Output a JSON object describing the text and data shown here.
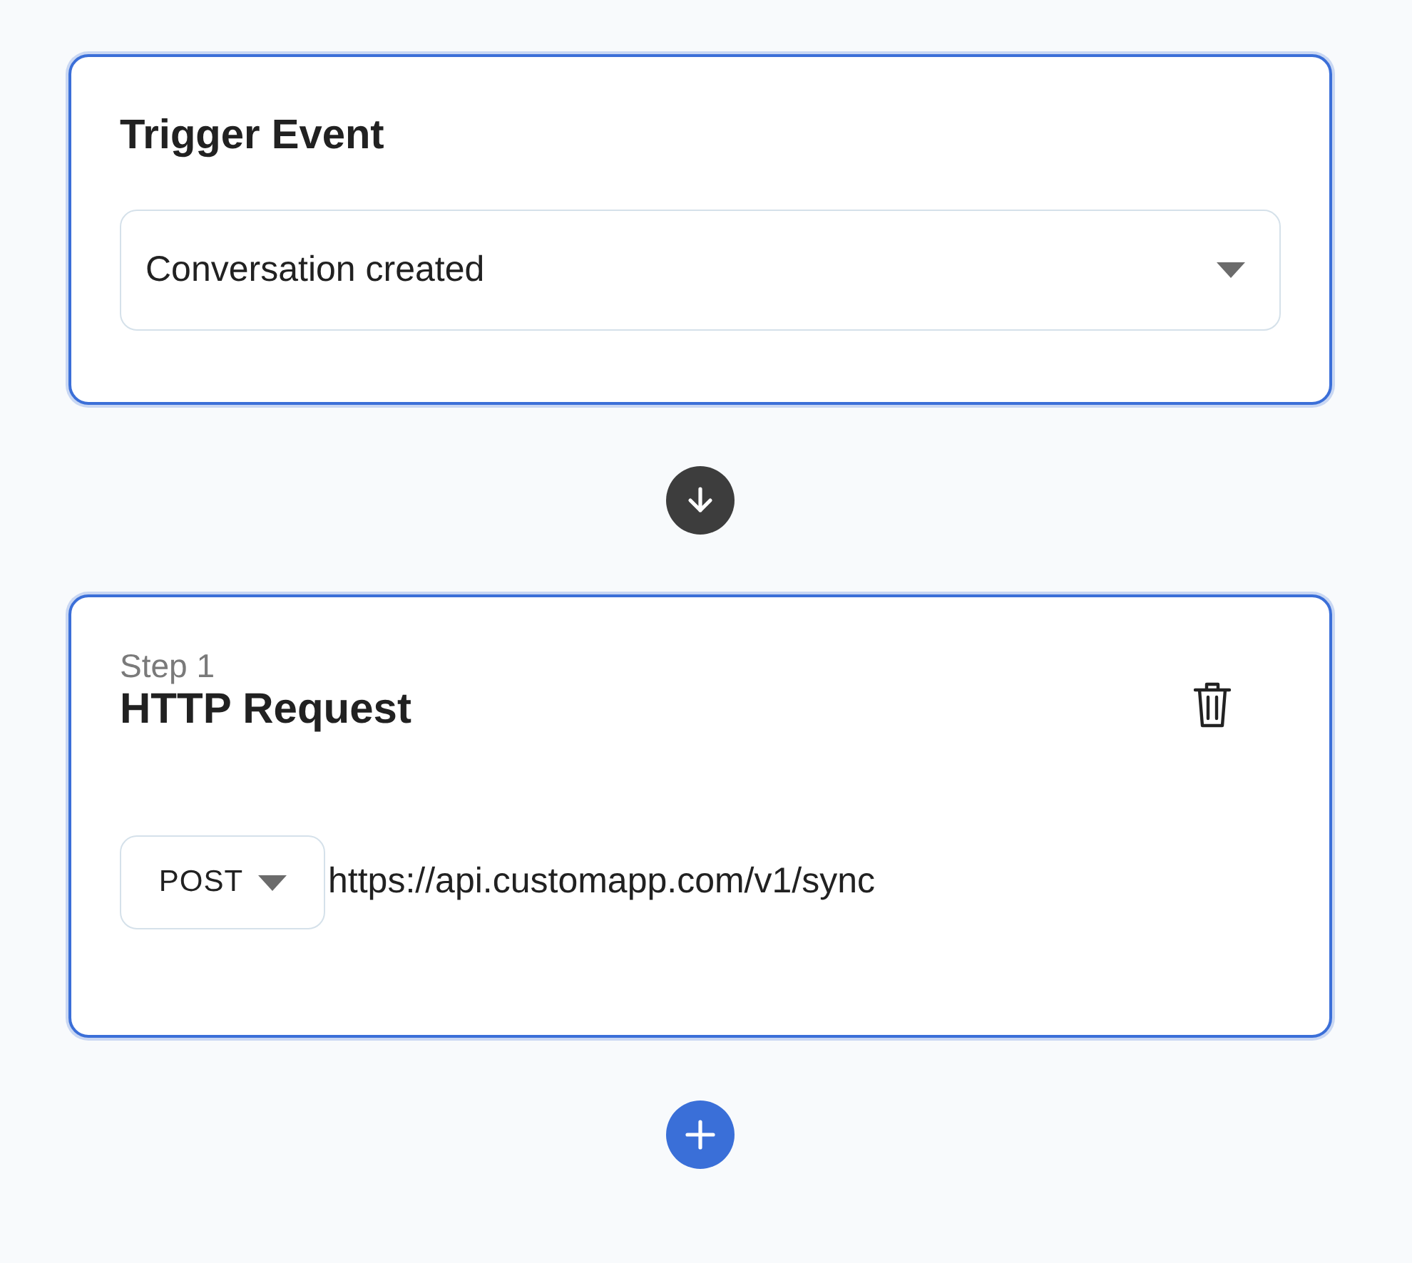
{
  "trigger": {
    "title": "Trigger Event",
    "event": "Conversation created"
  },
  "steps": [
    {
      "label": "Step 1",
      "title": "HTTP Request",
      "method": "POST",
      "url": "https://api.customapp.com/v1/sync"
    }
  ]
}
